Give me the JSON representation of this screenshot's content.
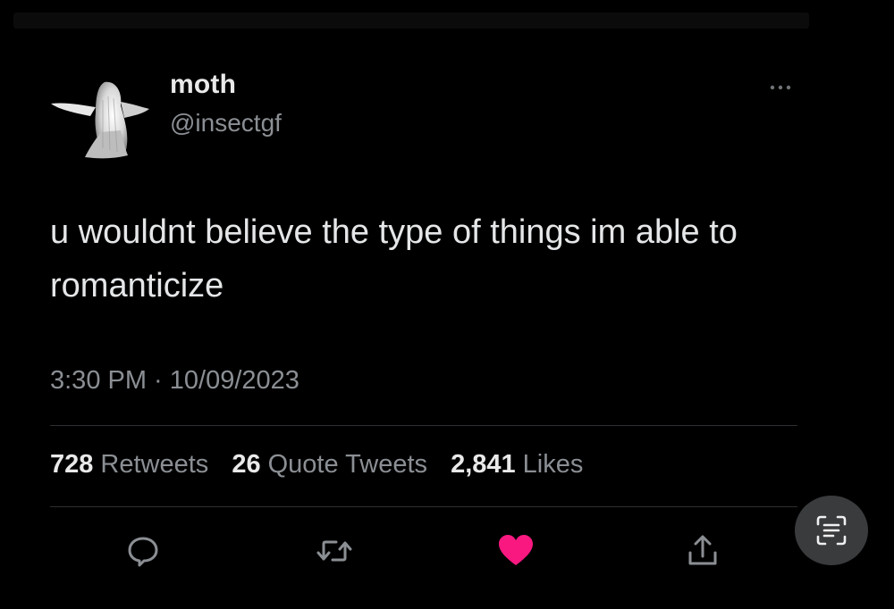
{
  "tweet": {
    "display_name": "moth",
    "handle": "@insectgf",
    "text": "u wouldnt believe the type of things im able to romanticize",
    "timestamp": "3:30 PM · 10/09/2023"
  },
  "stats": {
    "retweets_count": "728",
    "retweets_label": "Retweets",
    "quotes_count": "26",
    "quotes_label": "Quote Tweets",
    "likes_count": "2,841",
    "likes_label": "Likes"
  },
  "actions": {
    "reply_icon": "reply-icon",
    "retweet_icon": "retweet-icon",
    "like_icon": "heart-icon",
    "share_icon": "share-icon",
    "liked": true
  },
  "colors": {
    "background": "#000000",
    "text_primary": "#e4e6e8",
    "text_secondary": "#8b8f94",
    "like_active": "#f91880"
  }
}
